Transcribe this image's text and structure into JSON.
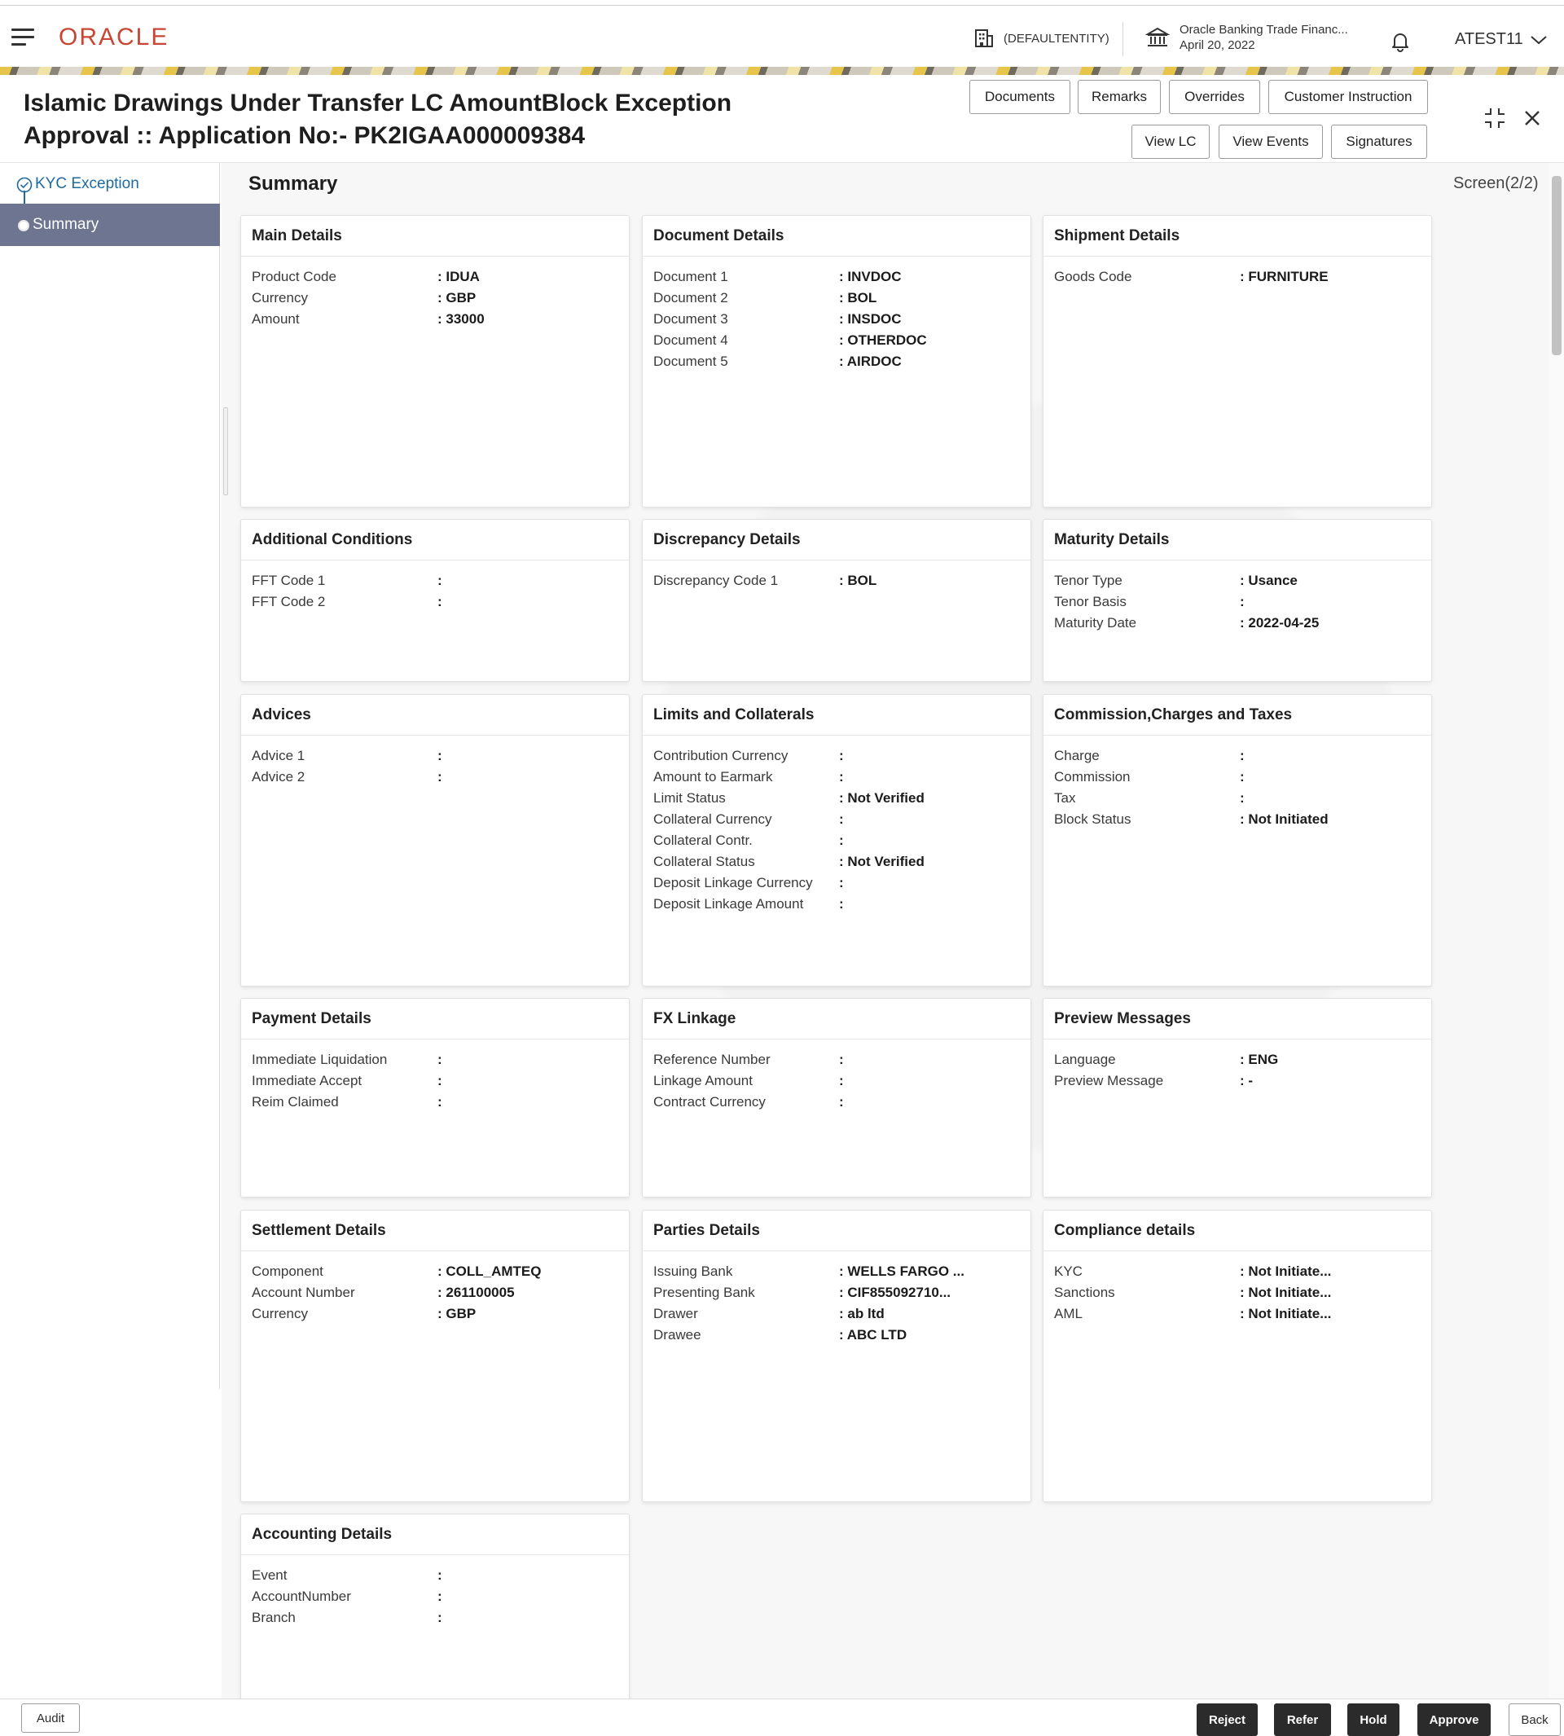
{
  "header": {
    "logo": "ORACLE",
    "entity": "(DEFAULTENTITY)",
    "bank_name": "Oracle Banking Trade Financ...",
    "bank_date": "April 20, 2022",
    "user": "ATEST11"
  },
  "page": {
    "title_line1": "Islamic Drawings Under Transfer LC AmountBlock Exception",
    "title_line2": "Approval :: Application No:- PK2IGAA000009384",
    "summary_title": "Summary",
    "screen_label": "Screen(2/2)"
  },
  "toolbar": {
    "documents": "Documents",
    "remarks": "Remarks",
    "overrides": "Overrides",
    "customer_instruction": "Customer Instruction",
    "view_lc": "View LC",
    "view_events": "View Events",
    "signatures": "Signatures"
  },
  "nav": {
    "items": [
      {
        "label": "KYC Exception"
      },
      {
        "label": "Summary"
      }
    ]
  },
  "cards": {
    "main": {
      "title": "Main Details",
      "rows": [
        {
          "label": "Product Code",
          "value": ": IDUA"
        },
        {
          "label": "Currency",
          "value": ": GBP"
        },
        {
          "label": "Amount",
          "value": ": 33000"
        }
      ]
    },
    "document": {
      "title": "Document Details",
      "rows": [
        {
          "label": "Document 1",
          "value": ": INVDOC"
        },
        {
          "label": "Document 2",
          "value": ": BOL"
        },
        {
          "label": "Document 3",
          "value": ": INSDOC"
        },
        {
          "label": "Document 4",
          "value": ": OTHERDOC"
        },
        {
          "label": "Document 5",
          "value": ": AIRDOC"
        }
      ]
    },
    "shipment": {
      "title": "Shipment Details",
      "rows": [
        {
          "label": "Goods Code",
          "value": ": FURNITURE"
        }
      ]
    },
    "additional": {
      "title": "Additional Conditions",
      "rows": [
        {
          "label": "FFT Code 1",
          "value": ":"
        },
        {
          "label": "FFT Code 2",
          "value": ":"
        }
      ]
    },
    "discrepancy": {
      "title": "Discrepancy Details",
      "rows": [
        {
          "label": "Discrepancy Code 1",
          "value": ": BOL"
        }
      ]
    },
    "maturity": {
      "title": "Maturity Details",
      "rows": [
        {
          "label": "Tenor Type",
          "value": ": Usance"
        },
        {
          "label": "Tenor Basis",
          "value": ":"
        },
        {
          "label": "Maturity Date",
          "value": ": 2022-04-25"
        }
      ]
    },
    "advices": {
      "title": "Advices",
      "rows": [
        {
          "label": "Advice 1",
          "value": ":"
        },
        {
          "label": "Advice 2",
          "value": ":"
        }
      ]
    },
    "limits": {
      "title": "Limits and Collaterals",
      "rows": [
        {
          "label": "Contribution Currency",
          "value": ":"
        },
        {
          "label": "Amount to Earmark",
          "value": ":"
        },
        {
          "label": "Limit Status",
          "value": ": Not Verified"
        },
        {
          "label": "Collateral Currency",
          "value": ":"
        },
        {
          "label": "Collateral Contr.",
          "value": ":"
        },
        {
          "label": "Collateral Status",
          "value": ": Not Verified"
        },
        {
          "label": "Deposit Linkage Currency",
          "value": ":"
        },
        {
          "label": "Deposit Linkage Amount",
          "value": ":"
        }
      ]
    },
    "commission": {
      "title": "Commission,Charges and Taxes",
      "rows": [
        {
          "label": "Charge",
          "value": ":"
        },
        {
          "label": "Commission",
          "value": ":"
        },
        {
          "label": "Tax",
          "value": ":"
        },
        {
          "label": "Block Status",
          "value": ": Not Initiated"
        }
      ]
    },
    "payment": {
      "title": "Payment Details",
      "rows": [
        {
          "label": "Immediate Liquidation",
          "value": ":"
        },
        {
          "label": "Immediate Accept",
          "value": ":"
        },
        {
          "label": "Reim Claimed",
          "value": ":"
        }
      ]
    },
    "fx": {
      "title": "FX Linkage",
      "rows": [
        {
          "label": "Reference Number",
          "value": ":"
        },
        {
          "label": "Linkage Amount",
          "value": ":"
        },
        {
          "label": "Contract Currency",
          "value": ":"
        }
      ]
    },
    "preview": {
      "title": "Preview Messages",
      "rows": [
        {
          "label": "Language",
          "value": ": ENG"
        },
        {
          "label": "Preview Message",
          "value": ": -"
        }
      ]
    },
    "settlement": {
      "title": "Settlement Details",
      "rows": [
        {
          "label": "Component",
          "value": ": COLL_AMTEQ"
        },
        {
          "label": "Account Number",
          "value": ": 261100005"
        },
        {
          "label": "Currency",
          "value": ": GBP"
        }
      ]
    },
    "parties": {
      "title": "Parties Details",
      "rows": [
        {
          "label": "Issuing Bank",
          "value": ": WELLS FARGO ..."
        },
        {
          "label": "Presenting Bank",
          "value": ": CIF855092710..."
        },
        {
          "label": "Drawer",
          "value": ": ab ltd"
        },
        {
          "label": "Drawee",
          "value": ": ABC LTD"
        }
      ]
    },
    "compliance": {
      "title": "Compliance details",
      "rows": [
        {
          "label": "KYC",
          "value": ": Not Initiate..."
        },
        {
          "label": "Sanctions",
          "value": ": Not Initiate..."
        },
        {
          "label": "AML",
          "value": ": Not Initiate..."
        }
      ]
    },
    "accounting": {
      "title": "Accounting Details",
      "rows": [
        {
          "label": "Event",
          "value": ":"
        },
        {
          "label": "AccountNumber",
          "value": ":"
        },
        {
          "label": "Branch",
          "value": ":"
        }
      ]
    }
  },
  "footer": {
    "audit": "Audit",
    "reject": "Reject",
    "refer": "Refer",
    "hold": "Hold",
    "approve": "Approve",
    "back": "Back"
  },
  "colors": {
    "brand": "#c74634",
    "nav_active": "#6d7590",
    "link": "#1e6aa2",
    "action_button": "#2b2b2b"
  },
  "icons": [
    "hamburger-icon",
    "building-icon",
    "bank-icon",
    "bell-icon",
    "chevron-down-icon",
    "check-circle-icon",
    "collapse-icon",
    "close-icon"
  ]
}
